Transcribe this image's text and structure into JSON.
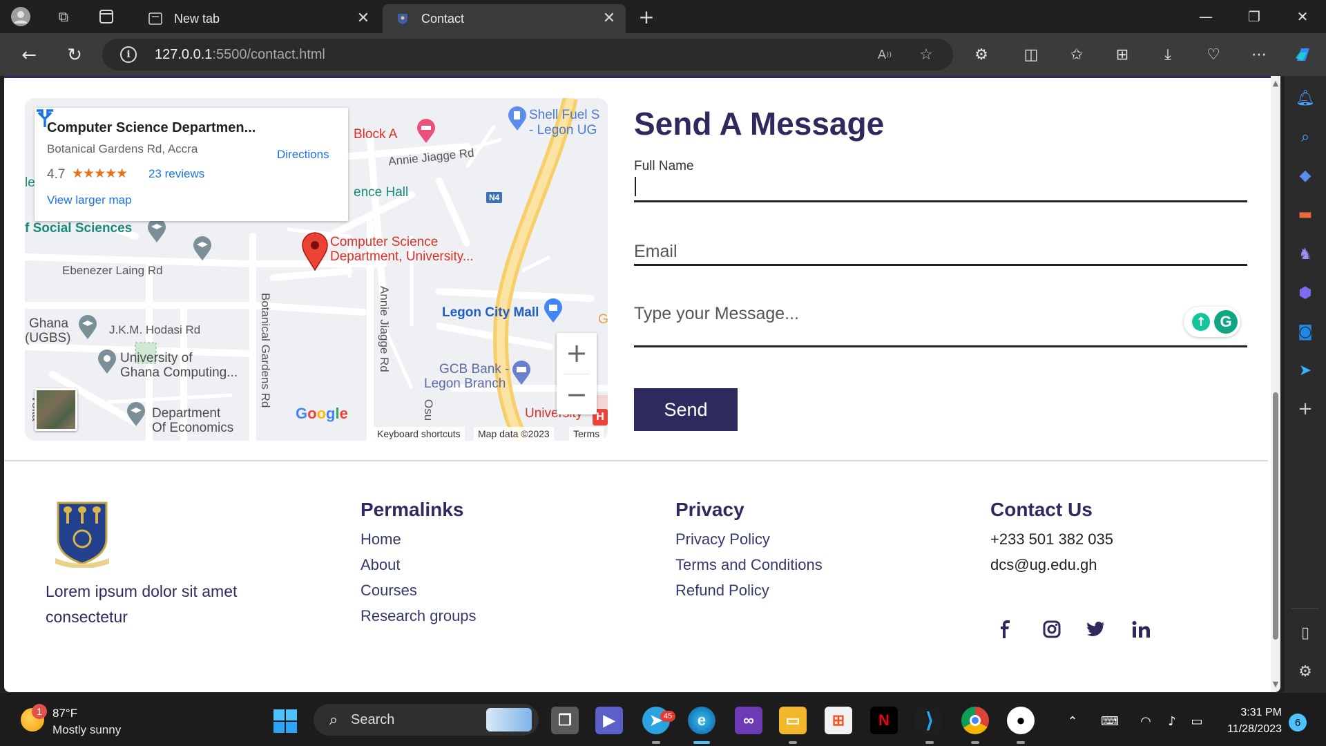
{
  "browser": {
    "tabs": [
      {
        "label": "New tab",
        "icon": "new-tab-icon"
      },
      {
        "label": "Contact",
        "icon": "site-favicon"
      }
    ],
    "url_host": "127.0.0.1",
    "url_rest": ":5500/contact.html"
  },
  "map": {
    "place_title": "Computer Science Departmen...",
    "place_address": "Botanical Gardens Rd, Accra",
    "rating": "4.7",
    "stars": "★★★★★",
    "reviews": "23 reviews",
    "view_larger": "View larger map",
    "directions": "Directions",
    "marker_label_1": "Computer Science",
    "marker_label_2": "Department, University...",
    "labels": {
      "block_a": "Block A",
      "shell_1": "Shell Fuel S",
      "shell_2": "- Legon UG",
      "annie_rd_top": "Annie Jiagge Rd",
      "ence_hall": "ence Hall",
      "n4": "N4",
      "social_sciences": "f Social Sciences",
      "ebenezer": "Ebenezer Laing Rd",
      "ghana_1": "Ghana",
      "ghana_2": "(UGBS)",
      "hodasi": "J.K.M. Hodasi Rd",
      "ug_computing_1": "University of",
      "ug_computing_2": "Ghana Computing...",
      "volta": "Volta",
      "botanical_rd": "Botanical Gardens Rd",
      "annie_rd_v": "Annie Jiagge Rd",
      "legon_mall": "Legon City Mall",
      "gcb_1": "GCB Bank -",
      "gcb_2": "Legon Branch",
      "econ_1": "Department",
      "econ_2": "Of Economics",
      "osu": "Osu",
      "university": "University",
      "le": "le",
      "g_edge": "G"
    },
    "google": "Google",
    "keyboard_shortcuts": "Keyboard shortcuts",
    "map_data": "Map data ©2023",
    "terms": "Terms"
  },
  "form": {
    "title": "Send A Message",
    "full_name_label": "Full Name",
    "email_placeholder": "Email",
    "message_placeholder": "Type your Message...",
    "send_label": "Send"
  },
  "footer": {
    "about": "Lorem ipsum dolor sit amet consectetur",
    "permalinks": {
      "heading": "Permalinks",
      "links": [
        "Home",
        "About",
        "Courses",
        "Research groups"
      ]
    },
    "privacy": {
      "heading": "Privacy",
      "links": [
        "Privacy Policy",
        "Terms and Conditions",
        "Refund Policy"
      ]
    },
    "contact": {
      "heading": "Contact Us",
      "phone": "+233 501 382 035",
      "email": "dcs@ug.edu.gh"
    },
    "social": [
      "facebook-icon",
      "instagram-icon",
      "twitter-icon",
      "linkedin-icon"
    ]
  },
  "taskbar": {
    "weather_badge": "1",
    "weather_temp": "87°F",
    "weather_desc": "Mostly sunny",
    "search_label": "Search",
    "telegram_badge": "45",
    "time": "3:31 PM",
    "date": "11/28/2023",
    "notifications": "6"
  },
  "colors": {
    "brand": "#2e2a5e",
    "accent_link": "#1a73e8"
  }
}
